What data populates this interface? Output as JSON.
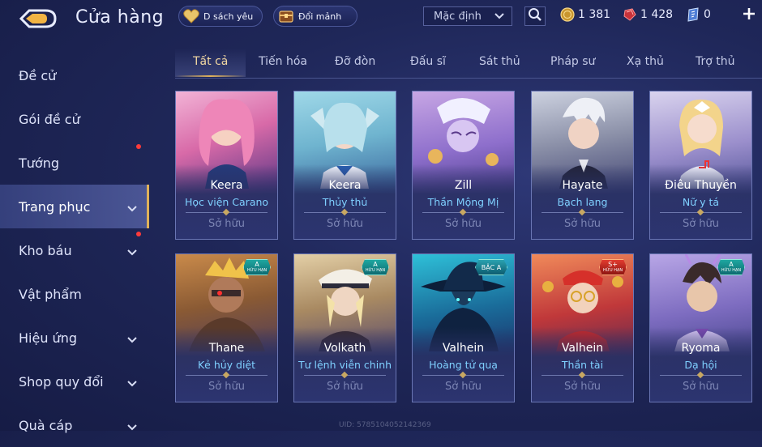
{
  "header": {
    "title": "Cửa hàng",
    "favorites_label": "D sách yêu",
    "swap_label": "Đổi mảnh",
    "sort_value": "Mặc định",
    "currency": [
      {
        "name": "gold-coin",
        "value": "1 381"
      },
      {
        "name": "ruby",
        "value": "1 428"
      },
      {
        "name": "voucher",
        "value": "0"
      }
    ]
  },
  "sidebar": {
    "items": [
      {
        "label": "Đề cử",
        "chevron": false,
        "dot": false,
        "active": false
      },
      {
        "label": "Gói đề cử",
        "chevron": false,
        "dot": true,
        "active": false
      },
      {
        "label": "Tướng",
        "chevron": false,
        "dot": false,
        "active": false
      },
      {
        "label": "Trang phục",
        "chevron": true,
        "dot": false,
        "active": true
      },
      {
        "label": "Kho báu",
        "chevron": true,
        "dot": true,
        "active": false
      },
      {
        "label": "Vật phẩm",
        "chevron": false,
        "dot": false,
        "active": false
      },
      {
        "label": "Hiệu ứng",
        "chevron": true,
        "dot": false,
        "active": false
      },
      {
        "label": "Shop quy đổi",
        "chevron": true,
        "dot": false,
        "active": false
      },
      {
        "label": "Quà cáp",
        "chevron": true,
        "dot": false,
        "active": false
      }
    ]
  },
  "tabs": [
    {
      "label": "Tất cả",
      "active": true
    },
    {
      "label": "Tiến hóa",
      "active": false
    },
    {
      "label": "Đỡ đòn",
      "active": false
    },
    {
      "label": "Đấu sĩ",
      "active": false
    },
    {
      "label": "Sát thủ",
      "active": false
    },
    {
      "label": "Pháp sư",
      "active": false
    },
    {
      "label": "Xạ thủ",
      "active": false
    },
    {
      "label": "Trợ thủ",
      "active": false
    }
  ],
  "skins": [
    {
      "hero": "Keera",
      "skin": "Học viện Carano",
      "status": "Sở hữu",
      "badge": "",
      "badge_sub": ""
    },
    {
      "hero": "Keera",
      "skin": "Thủy thủ",
      "status": "Sở hữu",
      "badge": "",
      "badge_sub": ""
    },
    {
      "hero": "Zill",
      "skin": "Thần Mộng Mị",
      "status": "Sở hữu",
      "badge": "",
      "badge_sub": ""
    },
    {
      "hero": "Hayate",
      "skin": "Bạch lang",
      "status": "Sở hữu",
      "badge": "",
      "badge_sub": ""
    },
    {
      "hero": "Điêu Thuyền",
      "skin": "Nữ y tá",
      "status": "Sở hữu",
      "badge": "",
      "badge_sub": ""
    },
    {
      "hero": "Thane",
      "skin": "Kẻ hủy diệt",
      "status": "Sở hữu",
      "badge": "A",
      "badge_sub": "HỮU HẠN"
    },
    {
      "hero": "Volkath",
      "skin": "Tư lệnh viễn chinh",
      "status": "Sở hữu",
      "badge": "A",
      "badge_sub": "HỮU HẠN"
    },
    {
      "hero": "Valhein",
      "skin": "Hoàng tử quạ",
      "status": "Sở hữu",
      "badge": "BẬC A",
      "badge_sub": ""
    },
    {
      "hero": "Valhein",
      "skin": "Thần tài",
      "status": "Sở hữu",
      "badge": "S+",
      "badge_sub": "HỮU HẠN"
    },
    {
      "hero": "Ryoma",
      "skin": "Dạ hội",
      "status": "Sở hữu",
      "badge": "A",
      "badge_sub": "HỮU HẠN"
    }
  ],
  "uid_text": "UID: 5785104052142369",
  "colors": {
    "accent_gold": "#e0b25a",
    "skin_name": "#7fd0ff",
    "notification_dot": "#ff3a3a"
  }
}
